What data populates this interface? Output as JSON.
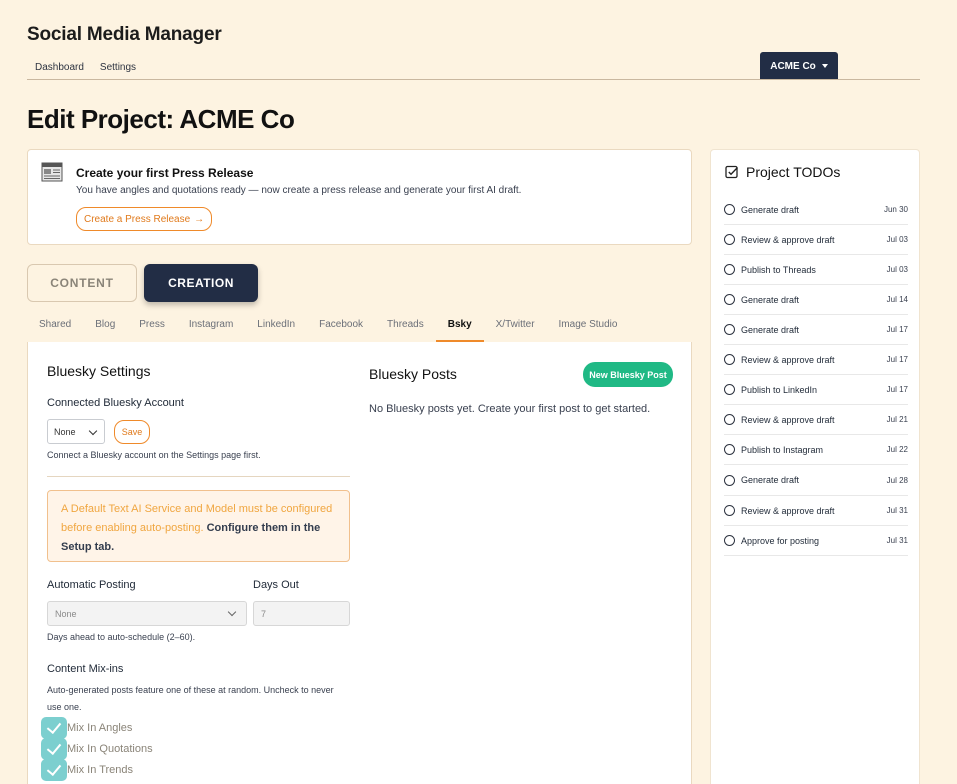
{
  "app": {
    "title": "Social Media Manager"
  },
  "nav": {
    "items": [
      "Dashboard",
      "Settings"
    ]
  },
  "org": {
    "label": "ACME Co"
  },
  "page": {
    "title": "Edit Project: ACME Co"
  },
  "banner": {
    "title": "Create your first Press Release",
    "description": "You have angles and quotations ready — now create a press release and generate your first AI draft.",
    "button_label": "Create a Press Release",
    "button_arrow": "→"
  },
  "modes": {
    "content": "CONTENT",
    "creation": "CREATION"
  },
  "tabs": [
    "Shared",
    "Blog",
    "Press",
    "Instagram",
    "LinkedIn",
    "Facebook",
    "Threads",
    "Bsky",
    "X/Twitter",
    "Image Studio"
  ],
  "active_tab": "Bsky",
  "settings": {
    "title": "Bluesky Settings",
    "account_label": "Connected Bluesky Account",
    "account_value": "None",
    "save_label": "Save",
    "account_hint": "Connect a Bluesky account on the Settings page first.",
    "warning_text": "A Default Text AI Service and Model must be configured before enabling auto-posting.",
    "warning_link": "Configure them in the Setup tab.",
    "auto_posting_label": "Automatic Posting",
    "auto_posting_value": "None",
    "days_out_label": "Days Out",
    "days_out_value": "7",
    "days_hint": "Days ahead to auto-schedule (2–60).",
    "mixins_label": "Content Mix-ins",
    "mixins_desc": "Auto-generated posts feature one of these at random. Uncheck to never use one.",
    "mixins": [
      "Mix In Angles",
      "Mix In Quotations",
      "Mix In Trends"
    ]
  },
  "posts": {
    "title": "Bluesky Posts",
    "new_button": "New Bluesky Post",
    "empty_text": "No Bluesky posts yet. Create your first post to get started."
  },
  "todos": {
    "title": "Project TODOs",
    "items": [
      {
        "label": "Generate draft",
        "date": "Jun 30"
      },
      {
        "label": "Review & approve draft",
        "date": "Jul 03"
      },
      {
        "label": "Publish to Threads",
        "date": "Jul 03"
      },
      {
        "label": "Generate draft",
        "date": "Jul 14"
      },
      {
        "label": "Generate draft",
        "date": "Jul 17"
      },
      {
        "label": "Review & approve draft",
        "date": "Jul 17"
      },
      {
        "label": "Publish to LinkedIn",
        "date": "Jul 17"
      },
      {
        "label": "Review & approve draft",
        "date": "Jul 21"
      },
      {
        "label": "Publish to Instagram",
        "date": "Jul 22"
      },
      {
        "label": "Generate draft",
        "date": "Jul 28"
      },
      {
        "label": "Review & approve draft",
        "date": "Jul 31"
      },
      {
        "label": "Approve for posting",
        "date": "Jul 31"
      }
    ]
  },
  "colors": {
    "background": "#fdf3e1",
    "navy": "#222d45",
    "accent_orange": "#ef8a2a",
    "green": "#20b985",
    "teal_checkbox": "#7ccfcf"
  }
}
